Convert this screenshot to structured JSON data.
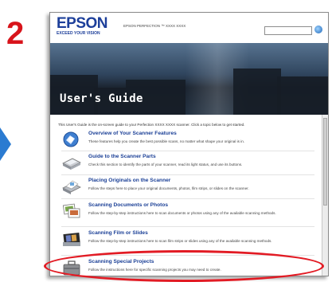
{
  "step": "2",
  "colors": {
    "step": "#d8141b",
    "arrow": "#2b7bd1",
    "brand": "#1d3f9a",
    "link": "#1a3f96",
    "highlight": "#e21b24"
  },
  "header": {
    "logo": "EPSON",
    "tagline": "EXCEED YOUR VISION",
    "product": "EPSON PERFECTION ™ XXXX XXXX",
    "search_value": ""
  },
  "banner": {
    "title": "User's Guide"
  },
  "intro": "This User's Guide is the on-screen guide to your Perfection XXXX XXXX scanner. Click a topic below to get started.",
  "items": [
    {
      "title": "Overview of Your Scanner Features",
      "description": "These features help you create the best possible scans, no matter what shape your original is in.",
      "icon": "overview-icon"
    },
    {
      "title": "Guide to the Scanner Parts",
      "description": "Check this section to identify the parts of your scanner, read its light status, and use its buttons.",
      "icon": "scanner-parts-icon"
    },
    {
      "title": "Placing Originals on the Scanner",
      "description": "Follow the steps here to place your original documents, photos, film strips, or slides on the scanner.",
      "icon": "placing-originals-icon"
    },
    {
      "title": "Scanning Documents or Photos",
      "description": "Follow the step-by-step instructions here to scan documents or photos using any of the available scanning methods.",
      "icon": "scan-photos-icon"
    },
    {
      "title": "Scanning Film or Slides",
      "description": "Follow the step-by-step instructions here to scan film strips or slides using any of the available scanning methods.",
      "icon": "scan-film-icon"
    },
    {
      "title": "Scanning Special Projects",
      "description": "Follow the instructions here for specific scanning projects you may need to create.",
      "icon": "special-projects-icon"
    }
  ]
}
